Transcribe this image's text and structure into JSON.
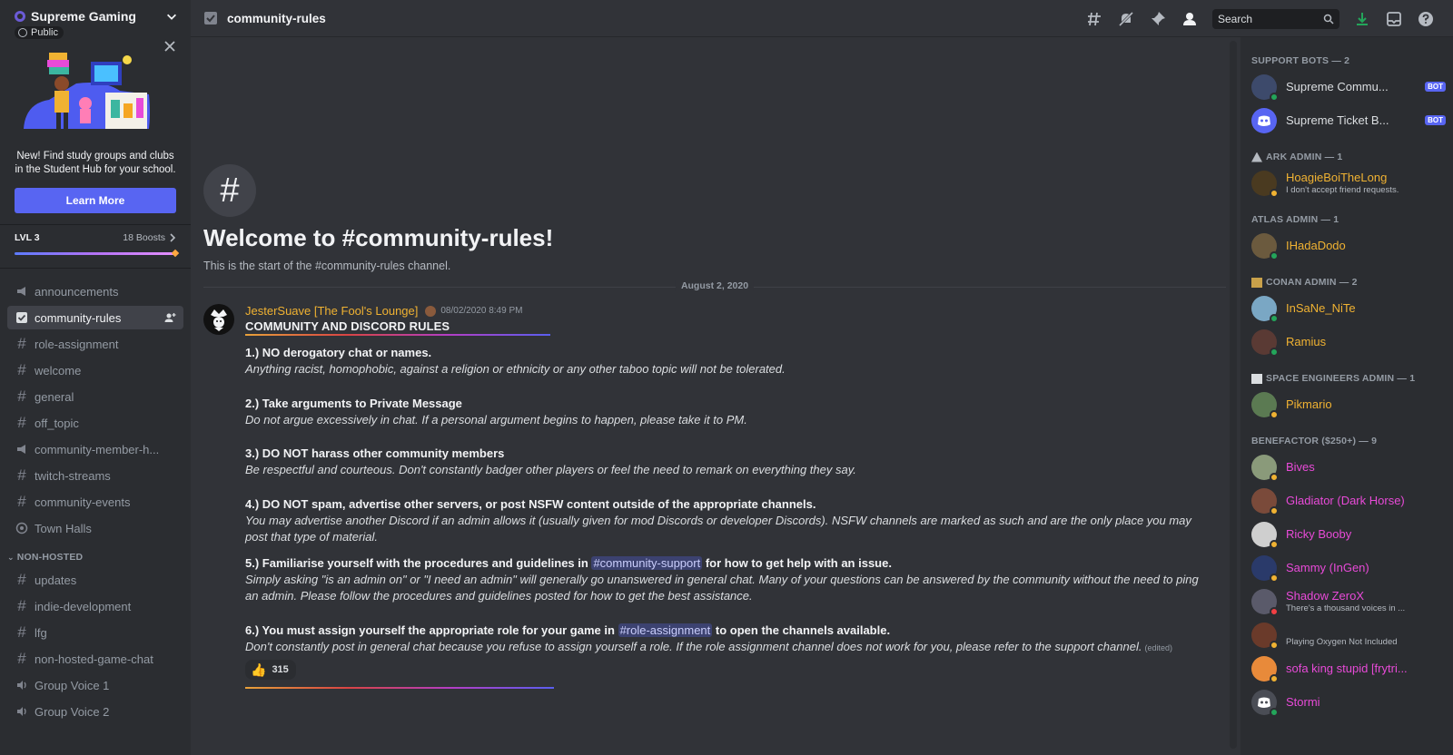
{
  "server": {
    "name": "Supreme Gaming",
    "visibility": "Public"
  },
  "promo": {
    "text": "New! Find study groups and clubs in the Student Hub for your school.",
    "button": "Learn More"
  },
  "boost": {
    "level": "LVL 3",
    "count": "18 Boosts",
    "progress": 1.0
  },
  "channels": [
    {
      "name": "announcements",
      "icon": "megaphone-icon"
    },
    {
      "name": "community-rules",
      "icon": "rules-icon",
      "active": true
    },
    {
      "name": "role-assignment",
      "icon": "hash-icon"
    },
    {
      "name": "welcome",
      "icon": "hash-icon"
    },
    {
      "name": "general",
      "icon": "hash-icon"
    },
    {
      "name": "off_topic",
      "icon": "hash-icon"
    },
    {
      "name": "community-member-h...",
      "icon": "megaphone-icon"
    },
    {
      "name": "twitch-streams",
      "icon": "hash-icon"
    },
    {
      "name": "community-events",
      "icon": "hash-icon"
    },
    {
      "name": "Town Halls",
      "icon": "stage-icon"
    }
  ],
  "category_non_hosted": "NON-HOSTED",
  "channels_non_hosted": [
    {
      "name": "updates",
      "icon": "hash-icon"
    },
    {
      "name": "indie-development",
      "icon": "hash-icon"
    },
    {
      "name": "lfg",
      "icon": "hash-icon"
    },
    {
      "name": "non-hosted-game-chat",
      "icon": "hash-icon"
    },
    {
      "name": "Group Voice 1",
      "icon": "speaker-icon"
    },
    {
      "name": "Group Voice 2",
      "icon": "speaker-icon"
    }
  ],
  "topbar": {
    "channel": "community-rules",
    "search_placeholder": "Search"
  },
  "welcome": {
    "title": "Welcome to #community-rules!",
    "subtitle": "This is the start of the #community-rules channel."
  },
  "date_divider": "August 2, 2020",
  "message": {
    "author": "JesterSuave [The Fool's Lounge]",
    "timestamp": "08/02/2020 8:49 PM",
    "heading": "COMMUNITY AND DISCORD RULES",
    "rules": [
      {
        "title": "1.) NO derogatory chat or names.",
        "desc": "Anything racist, homophobic, against a religion or ethnicity or any other taboo topic will not be tolerated."
      },
      {
        "title": "2.) Take arguments to Private Message",
        "desc": "Do not argue excessively in chat. If a personal argument begins to happen, please take it to PM."
      },
      {
        "title": "3.) DO NOT harass other community members",
        "desc": "Be respectful and courteous. Don't constantly badger other players or feel the need to remark on everything they say."
      },
      {
        "title": "4.) DO NOT spam, advertise other servers, or post NSFW content outside of the appropriate channels.",
        "desc": "You may advertise another Discord if an admin allows it (usually given for mod Discords or developer Discords). NSFW channels are marked as such and are the only place you may post that type of material."
      }
    ],
    "rule5": {
      "title_before": "5.) Familiarise yourself with the procedures and guidelines in",
      "mention": "#community-support",
      "title_after": "for how to get help with an issue.",
      "desc": "Simply asking \"is an admin on\" or \"I need an admin\" will generally go unanswered in general chat. Many of your questions can be answered by the community without the need to ping an admin. Please follow the procedures and guidelines posted for how to get the best assistance."
    },
    "rule6": {
      "title_before": "6.) You must assign yourself the appropriate role for your game in",
      "mention": "#role-assignment",
      "title_after": "to open the channels available.",
      "desc": "Don't constantly post in general chat because you refuse to assign yourself a role. If the role assignment channel does not work for you, please refer to the support channel.",
      "edited": "(edited)"
    },
    "reaction": {
      "emoji": "👍",
      "count": "315"
    }
  },
  "member_groups": [
    {
      "title": "SUPPORT BOTS — 2",
      "icon": "",
      "members": [
        {
          "name": "Supreme Commu...",
          "bot": "BOT",
          "color": "#dbdee1",
          "avatar": "#3d4a6b",
          "status": "#23a55a"
        },
        {
          "name": "Supreme Ticket B...",
          "bot": "BOT",
          "color": "#dbdee1",
          "avatar": "#5865f2",
          "status": ""
        }
      ]
    },
    {
      "title": "ARK ADMIN — 1",
      "icon": "ark-icon",
      "members": [
        {
          "name": "HoagieBoiTheLong",
          "sub": "I don't accept friend requests.",
          "color": "#f0b232",
          "avatar": "#4a3a20",
          "status": "#f0b232"
        }
      ]
    },
    {
      "title": "ATLAS ADMIN — 1",
      "icon": "",
      "members": [
        {
          "name": "IHadaDodo",
          "color": "#f0b232",
          "avatar": "#6b5a3e",
          "status": "#23a55a"
        }
      ]
    },
    {
      "title": "CONAN ADMIN — 2",
      "icon": "conan-icon",
      "members": [
        {
          "name": "InSaNe_NiTe",
          "color": "#f0b232",
          "avatar": "#7aa7c4",
          "status": "#23a55a"
        },
        {
          "name": "Ramius",
          "color": "#f0b232",
          "avatar": "#5a3a34",
          "status": "#23a55a"
        }
      ]
    },
    {
      "title": "SPACE ENGINEERS ADMIN — 1",
      "icon": "space-engineers-icon",
      "members": [
        {
          "name": "Pikmario",
          "color": "#f0b232",
          "avatar": "#5b7a52",
          "status": "#f0b232"
        }
      ]
    },
    {
      "title": "BENEFACTOR ($250+) — 9",
      "icon": "",
      "members": [
        {
          "name": "Bives",
          "color": "#e84ad8",
          "avatar": "#8a9a7a",
          "status": "#f0b232"
        },
        {
          "name": "Gladiator (Dark Horse)",
          "color": "#e84ad8",
          "avatar": "#7a4a3a",
          "status": "#f0b232"
        },
        {
          "name": "Ricky Booby",
          "color": "#e84ad8",
          "avatar": "#cfcfcf",
          "status": "#f0b232"
        },
        {
          "name": "Sammy (InGen)",
          "color": "#e84ad8",
          "avatar": "#2a3a6a",
          "status": "#f0b232"
        },
        {
          "name": "Shadow ZeroX",
          "sub": "There's a thousand voices in ...",
          "color": "#e84ad8",
          "avatar": "#5a5a6a",
          "status": "#f23f43"
        },
        {
          "name": "",
          "sub": "Playing Oxygen Not Included",
          "color": "#e84ad8",
          "avatar": "#6a3a2a",
          "status": "#f0b232"
        },
        {
          "name": "sofa king stupid [frytri...",
          "color": "#e84ad8",
          "avatar": "#e88a3a",
          "status": "#f0b232"
        },
        {
          "name": "Stormi",
          "color": "#e84ad8",
          "avatar": "#4a4d55",
          "status": "#23a55a"
        }
      ]
    }
  ],
  "colors": {
    "accent": "#5865f2",
    "admin": "#f0b232",
    "benefactor": "#e84ad8",
    "online": "#23a55a",
    "dnd": "#f23f43"
  }
}
